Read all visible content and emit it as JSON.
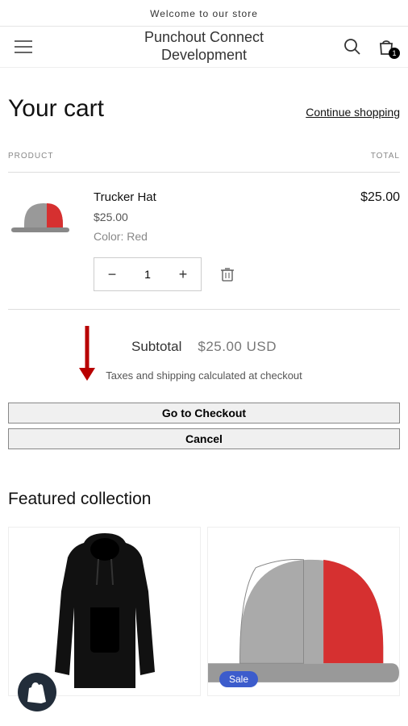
{
  "announcement": "Welcome to our store",
  "header": {
    "store_name_line1": "Punchout Connect",
    "store_name_line2": "Development",
    "cart_count": "1"
  },
  "cart": {
    "title": "Your cart",
    "continue_link": "Continue shopping",
    "col_product": "PRODUCT",
    "col_total": "TOTAL",
    "item": {
      "name": "Trucker Hat",
      "price": "$25.00",
      "variant": "Color: Red",
      "qty": "1",
      "line_total": "$25.00"
    },
    "subtotal_label": "Subtotal",
    "subtotal_value": "$25.00 USD",
    "tax_note": "Taxes and shipping calculated at checkout",
    "checkout_btn": "Go to Checkout",
    "cancel_btn": "Cancel"
  },
  "featured": {
    "title": "Featured collection",
    "sale_badge": "Sale"
  }
}
